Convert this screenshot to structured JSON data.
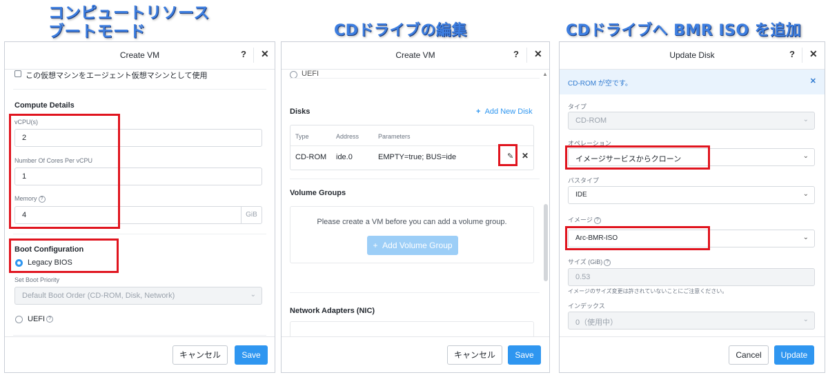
{
  "captions": {
    "panel1_line1": "コンピュートリソース",
    "panel1_line2": "ブートモード",
    "panel2": "CDドライブの編集",
    "panel3": "CDドライブへ BMR ISO を追加"
  },
  "panel1": {
    "title": "Create VM",
    "help": "?",
    "close": "✕",
    "agent_vm_label": "この仮想マシンをエージェント仮想マシンとして使用",
    "compute_details": "Compute Details",
    "vcpu_label": "vCPU(s)",
    "vcpu_value": "2",
    "cores_label": "Number Of Cores Per vCPU",
    "cores_value": "1",
    "memory_label": "Memory",
    "memory_value": "4",
    "memory_unit": "GiB",
    "boot_configuration": "Boot Configuration",
    "legacy_bios": "Legacy BIOS",
    "set_boot_priority": "Set Boot Priority",
    "boot_order": "Default Boot Order (CD-ROM, Disk, Network)",
    "uefi": "UEFI",
    "cancel": "キャンセル",
    "save": "Save"
  },
  "panel2": {
    "title": "Create VM",
    "help": "?",
    "close": "✕",
    "uefi_partial": "UEFI",
    "disks_title": "Disks",
    "add_new_disk": "Add New Disk",
    "col_type": "Type",
    "col_address": "Address",
    "col_parameters": "Parameters",
    "row_type": "CD-ROM",
    "row_address": "ide.0",
    "row_parameters": "EMPTY=true; BUS=ide",
    "volume_groups_title": "Volume Groups",
    "volume_groups_message": "Please create a VM before you can add a volume group.",
    "add_volume_group": "Add Volume Group",
    "network_adapters_title": "Network Adapters (NIC)",
    "cancel": "キャンセル",
    "save": "Save"
  },
  "panel3": {
    "title": "Update Disk",
    "help": "?",
    "close": "✕",
    "notice": "CD-ROM が空です。",
    "type_label": "タイプ",
    "type_value": "CD-ROM",
    "operation_label": "オペレーション",
    "operation_value": "イメージサービスからクローン",
    "bus_type_label": "バスタイプ",
    "bus_type_value": "IDE",
    "image_label": "イメージ",
    "image_value": "Arc-BMR-ISO",
    "size_label": "サイズ (GiB)",
    "size_value": "0.53",
    "size_note": "イメージのサイズ変更は許されていないことにご注意ください。",
    "index_label": "インデックス",
    "index_value": "0（使用中）",
    "cancel": "Cancel",
    "update": "Update"
  },
  "colors": {
    "primary": "#2f96f0",
    "highlight": "#e0141e",
    "caption": "#3d7ee0"
  },
  "icons": [
    "help-icon",
    "close-icon",
    "checkbox-icon",
    "radio-icon",
    "help-circle-icon",
    "chevron-down-icon",
    "plus-icon",
    "pencil-icon",
    "delete-icon"
  ]
}
